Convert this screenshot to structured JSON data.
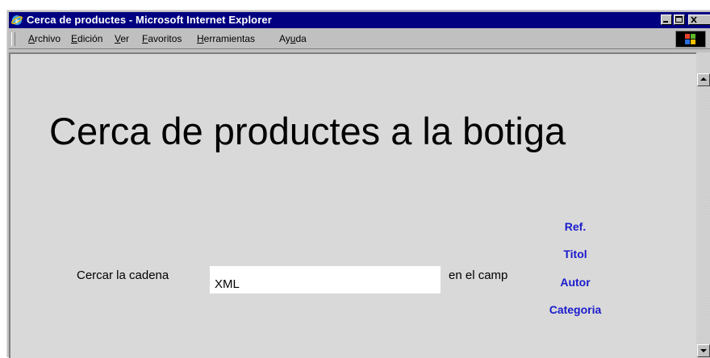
{
  "window": {
    "title": "Cerca de productes - Microsoft Internet Explorer"
  },
  "menu": [
    {
      "label": "Archivo",
      "mnemonic": "A",
      "rest": "rchivo"
    },
    {
      "label": "Edición",
      "mnemonic": "E",
      "rest": "dición"
    },
    {
      "label": "Ver",
      "mnemonic": "V",
      "rest": "er"
    },
    {
      "label": "Favoritos",
      "mnemonic": "F",
      "rest": "avoritos"
    },
    {
      "label": "Herramientas",
      "mnemonic": "H",
      "rest": "erramientas"
    },
    {
      "label": "Ayuda",
      "prefix": "Ay",
      "mnemonic": "u",
      "rest": "da"
    }
  ],
  "page": {
    "title": "Cerca de productes a la botiga",
    "search_label": "Cercar la cadena",
    "search_value": "XML",
    "field_label": "en el camp",
    "fields": [
      "Ref.",
      "Titol",
      "Autor",
      "Categoria"
    ]
  },
  "colors": {
    "title_bar": "#000080",
    "content_bg": "#d9d9d9",
    "link": "#1a1acd"
  },
  "icons": {
    "window": "ie-icon",
    "minimize": "minimize-icon",
    "maximize": "maximize-icon",
    "close": "close-icon",
    "throbber": "windows-logo-icon"
  }
}
